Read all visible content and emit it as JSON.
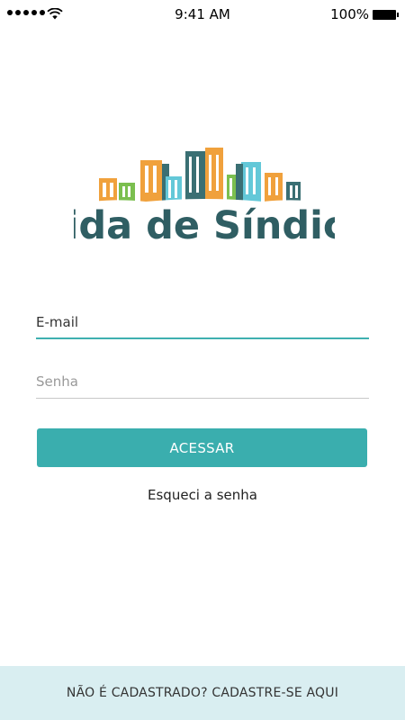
{
  "status_bar": {
    "time": "9:41 AM",
    "battery_percent": "100%",
    "icons": [
      "signal-dots-icon",
      "wifi-icon",
      "battery-icon"
    ]
  },
  "logo": {
    "text": "Vida de Síndico",
    "icon": "city-buildings-logo",
    "colors": {
      "text": "#2f5e63",
      "orange": "#f0a13c",
      "teal": "#3a6f73",
      "light_blue": "#63c8d8",
      "green": "#7bbf4f"
    }
  },
  "form": {
    "email_placeholder": "E-mail",
    "email_value": "",
    "password_placeholder": "Senha",
    "password_value": "",
    "submit_label": "ACESSAR",
    "forgot_label": "Esqueci a senha"
  },
  "footer": {
    "signup_label": "NÃO É CADASTRADO? CADASTRE-SE AQUI"
  },
  "colors": {
    "accent": "#3aaeae",
    "email_underline": "#3fb0b0",
    "footer_bg": "#d9eef1"
  }
}
